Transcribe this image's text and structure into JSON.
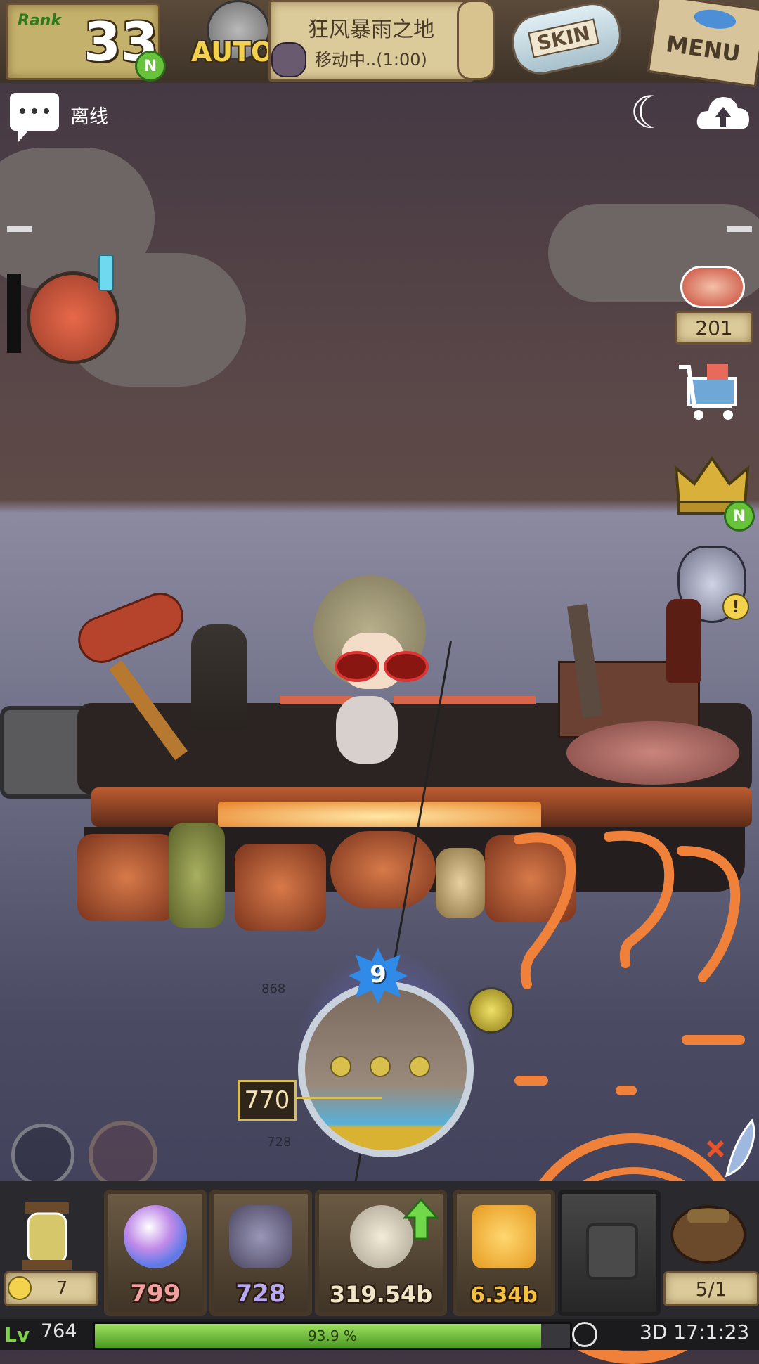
{
  "hud": {
    "rank_label": "Rank",
    "rank_value": "33",
    "rank_badge": "N",
    "auto_label": "AUTO",
    "location_name": "狂风暴雨之地",
    "location_status": "移动中..(1:00)",
    "skin_label": "SKIN",
    "menu_label": "MENU"
  },
  "chat": {
    "status": "离线"
  },
  "side": {
    "meat_count": "201",
    "crown_badge": "N",
    "cat_alert": "!"
  },
  "gauge": {
    "level": "9",
    "tick_high": "868",
    "tick_low": "728",
    "value": "770"
  },
  "items": [
    {
      "count": "799",
      "color": "#f0a0a0",
      "icon": "orb-icon"
    },
    {
      "count": "728",
      "color": "#b8a8f0",
      "icon": "shield-gem-icon"
    },
    {
      "count": "319.54b",
      "color": "#efe6c8",
      "icon": "gear-coin-icon"
    },
    {
      "count": "6.34b",
      "color": "#f3c040",
      "icon": "gold-icon"
    }
  ],
  "potion_count": "7",
  "slots_text": "5/1",
  "status": {
    "level_value": "764",
    "xp_percent": 93.9,
    "xp_text": "93.9 %",
    "time_value": "3D 17:1:23"
  },
  "colors": {
    "accent": "#f0813a",
    "xp_green": "#7fd34a"
  }
}
